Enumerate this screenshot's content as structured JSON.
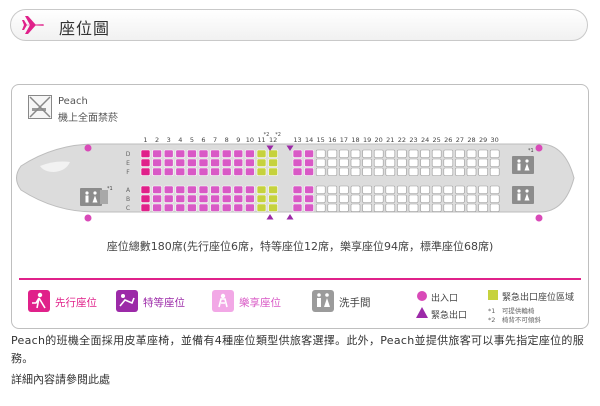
{
  "header": {
    "title": "座位圖"
  },
  "no_smoking": {
    "line1": "Peach",
    "line2": "機上全面禁菸"
  },
  "seat_map": {
    "rows": [
      "1",
      "2",
      "3",
      "4",
      "5",
      "6",
      "7",
      "8",
      "9",
      "10",
      "11",
      "12",
      "13",
      "14",
      "15",
      "16",
      "17",
      "18",
      "19",
      "20",
      "21",
      "22",
      "23",
      "24",
      "25",
      "26",
      "27",
      "28",
      "29",
      "30"
    ],
    "row_marks": {
      "11": "*2",
      "12": "*2"
    },
    "upper_letters": [
      "D",
      "E",
      "F"
    ],
    "lower_letters": [
      "A",
      "B",
      "C"
    ],
    "aisle_letter": "F"
  },
  "total_text": "座位總數180席(先行座位6席，特等座位12席，樂享座位94席，標準座位68席)",
  "legend": {
    "priority": "先行座位",
    "premium": "特等座位",
    "enjoy": "樂享座位",
    "lavatory": "洗手間",
    "exit": "出入口",
    "emergency": "緊急出口",
    "emergency_row": "緊急出口座位區域",
    "note1": "*1　可提供輪椅",
    "note2": "*2　椅背不可傾斜",
    "mark1": "*1"
  },
  "description": "Peach的班機全面採用皮革座椅，並備有4種座位類型供旅客選擇。此外，Peach並提供旅客可以事先指定座位的服務。",
  "link_text": "詳細內容請參閱此處",
  "colors": {
    "accent": "#e0218a",
    "enjoy": "#d959c6",
    "premium": "#9c2aa8",
    "emergency": "#c6d23d",
    "standard": "#ffffff"
  }
}
